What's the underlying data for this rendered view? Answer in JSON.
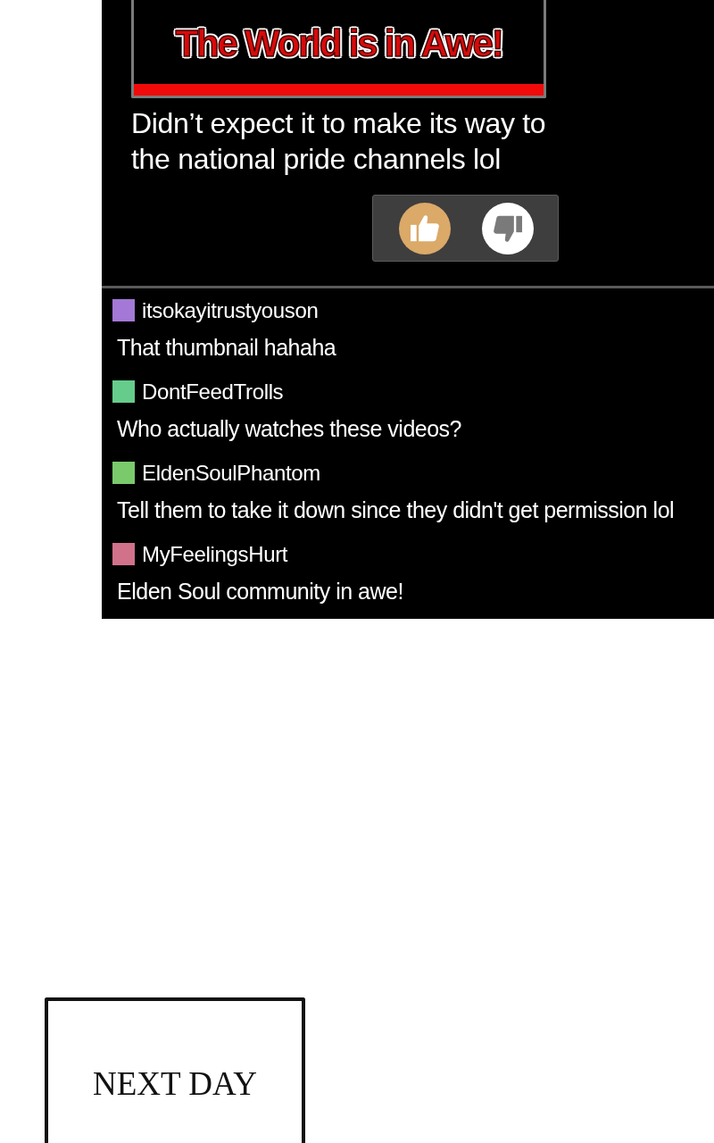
{
  "thumbnail": {
    "title": "The World is in Awe!"
  },
  "post": {
    "caption": "Didn’t expect it to make its way to the national pride channels lol",
    "votes": [
      {
        "kind": "like",
        "selected": true
      },
      {
        "kind": "dislike",
        "selected": false
      }
    ]
  },
  "comments": [
    {
      "username": "itsokayitrustyouson",
      "color": "#a378d6",
      "text": "That thumbnail hahaha"
    },
    {
      "username": "DontFeedTrolls",
      "color": "#66cc8c",
      "text": "Who actually watches these videos?"
    },
    {
      "username": "EldenSoulPhantom",
      "color": "#7aca6c",
      "text": "Tell them to take it down since they didn't get permission lol"
    },
    {
      "username": "MyFeelingsHurt",
      "color": "#d2728a",
      "text": "Elden Soul community in awe!"
    }
  ],
  "next_panel": {
    "caption": "NEXT DAY"
  }
}
